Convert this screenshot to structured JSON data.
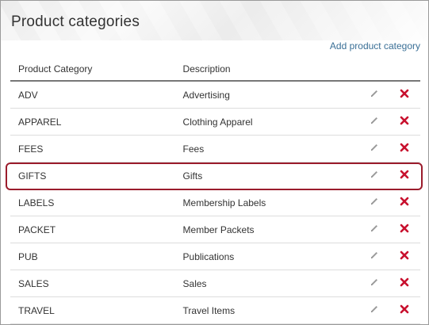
{
  "page": {
    "title": "Product categories"
  },
  "toolbar": {
    "add_label": "Add product category"
  },
  "table": {
    "headers": {
      "category": "Product Category",
      "description": "Description"
    },
    "rows": [
      {
        "category": "ADV",
        "description": "Advertising"
      },
      {
        "category": "APPAREL",
        "description": "Clothing Apparel"
      },
      {
        "category": "FEES",
        "description": "Fees"
      },
      {
        "category": "GIFTS",
        "description": "Gifts"
      },
      {
        "category": "LABELS",
        "description": "Membership Labels"
      },
      {
        "category": "PACKET",
        "description": "Member Packets"
      },
      {
        "category": "PUB",
        "description": "Publications"
      },
      {
        "category": "SALES",
        "description": "Sales"
      },
      {
        "category": "TRAVEL",
        "description": "Travel Items"
      }
    ],
    "highlighted_row": "GIFTS"
  },
  "icons": {
    "edit": "pencil-icon",
    "delete": "delete-x-icon"
  },
  "colors": {
    "link": "#3a6f96",
    "delete": "#c8102e",
    "highlight": "#9b1c2c",
    "edit": "#9a9a9a"
  }
}
